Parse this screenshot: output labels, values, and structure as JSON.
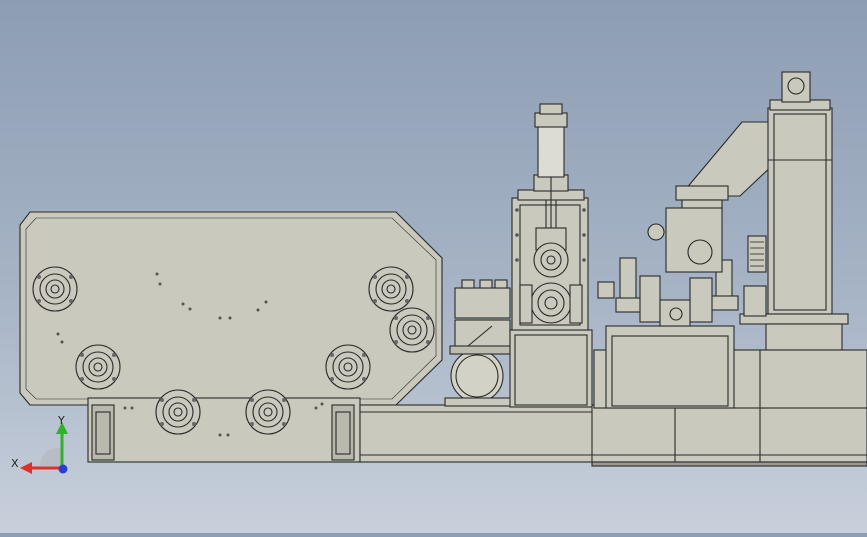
{
  "viewport": {
    "background_top": "#8d9db3",
    "background_bottom": "#c8d0db",
    "model_color": "#c9c9bd",
    "edge_color": "#2a2a2a"
  },
  "axis_triad": {
    "x_label": "X",
    "y_label": "Y",
    "x_color": "#e0302a",
    "y_color": "#2fb02f",
    "z_color": "#2a3fd0"
  }
}
